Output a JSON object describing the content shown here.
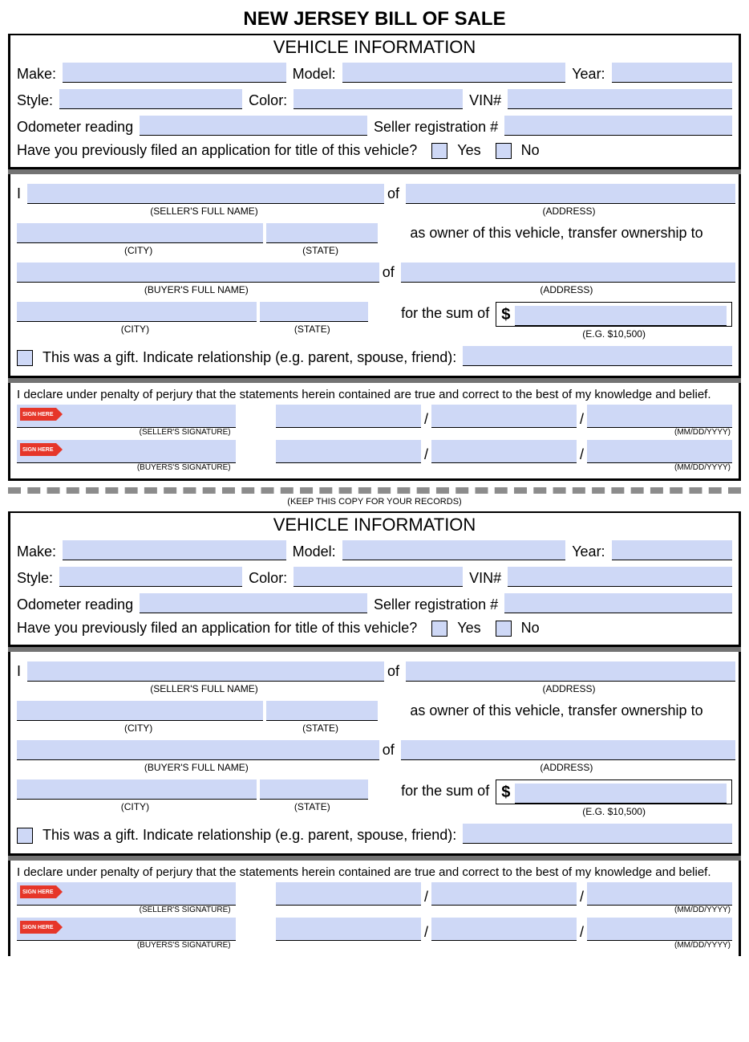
{
  "title": "NEW JERSEY BILL OF SALE",
  "vehicle_info_title": "VEHICLE INFORMATION",
  "labels": {
    "make": "Make:",
    "model": "Model:",
    "year": "Year:",
    "style": "Style:",
    "color": "Color:",
    "vin": "VIN#",
    "odometer": "Odometer reading",
    "seller_reg": "Seller registration #",
    "prev_filed": "Have you previously filed an application for title of this vehicle?",
    "yes": "Yes",
    "no": "No",
    "i": "I",
    "of": "of",
    "as_owner": "as owner of this vehicle, transfer ownership to",
    "for_sum": "for the sum of",
    "dollar": "$",
    "gift": "This was a gift. Indicate relationship (e.g. parent, spouse, friend):",
    "slash": "/"
  },
  "hints": {
    "seller_full_name": "(SELLER'S FULL NAME)",
    "address": "(ADDRESS)",
    "city": "(CITY)",
    "state": "(STATE)",
    "buyer_full_name": "(BUYER'S FULL NAME)",
    "sum_example": "(E.G. $10,500)",
    "seller_sig": "(SELLER'S SIGNATURE)",
    "buyer_sig": "(BUYER'S'S SIGNATURE)",
    "buyer_sig_correct": "(BUYERS'S SIGNATURE)",
    "date": "(MM/DD/YYYY)"
  },
  "declare": "I declare under penalty of perjury that the statements herein contained are true and correct to the best of my knowledge and belief.",
  "sign_here": "SIGN HERE",
  "keep_copy": "(KEEP THIS COPY FOR YOUR RECORDS)"
}
